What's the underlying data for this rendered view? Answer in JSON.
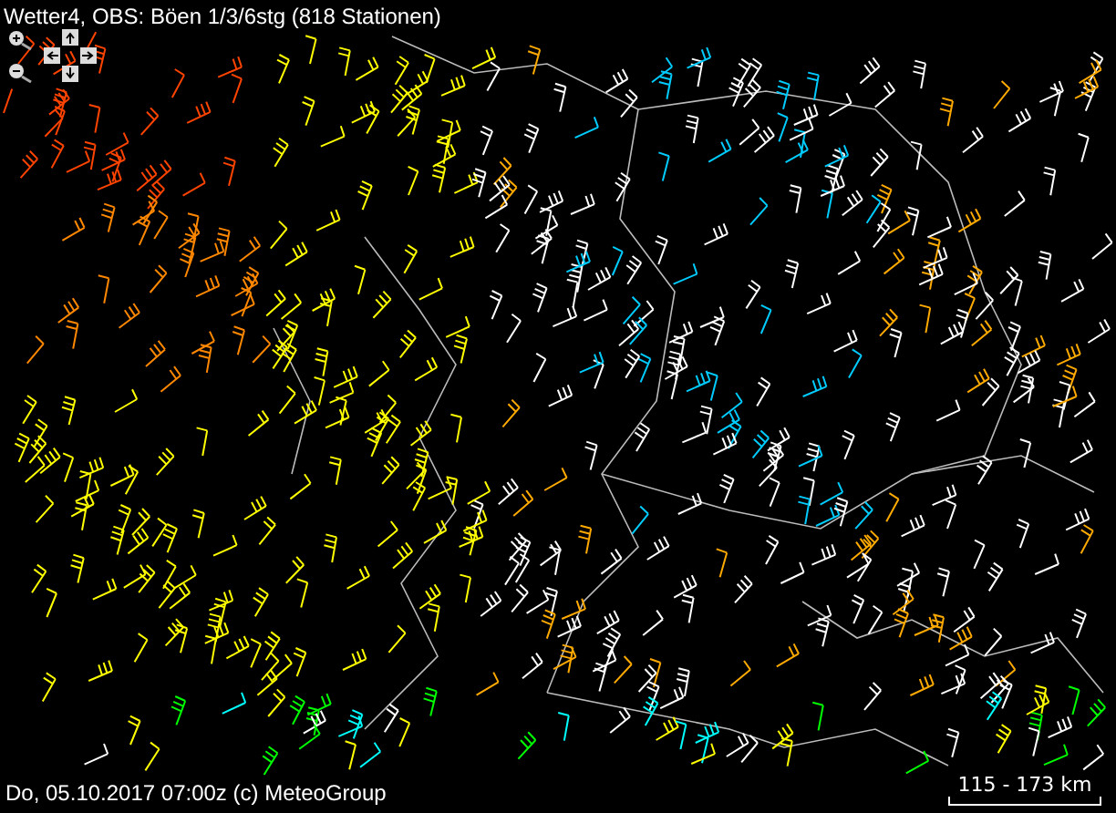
{
  "title": "Wetter4, OBS: Böen 1/3/6stg (818 Stationen)",
  "footer": "Do, 05.10.2017 07:00z (c) MeteoGroup",
  "scale_bar": {
    "label": "115 - 173 km"
  }
}
